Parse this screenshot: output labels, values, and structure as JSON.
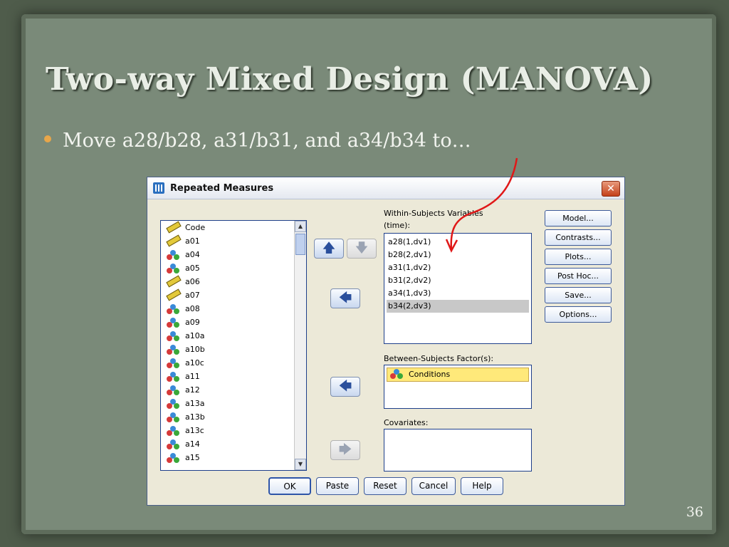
{
  "slide": {
    "title": "Two-way Mixed Design (MANOVA)",
    "bullet": "Move a28/b28, a31/b31, and a34/b34 to…",
    "page_number": "36",
    "accent_color": "#e8a64a",
    "annotation_arrow_color": "#e01818"
  },
  "dialog": {
    "title": "Repeated Measures",
    "close_label": "✕",
    "variables": [
      {
        "name": "Code",
        "icon": "scale-ruler-icon"
      },
      {
        "name": "a01",
        "icon": "scale-ruler-icon"
      },
      {
        "name": "a04",
        "icon": "nominal-icon"
      },
      {
        "name": "a05",
        "icon": "nominal-icon"
      },
      {
        "name": "a06",
        "icon": "scale-ruler-icon"
      },
      {
        "name": "a07",
        "icon": "scale-ruler-icon"
      },
      {
        "name": "a08",
        "icon": "nominal-icon"
      },
      {
        "name": "a09",
        "icon": "nominal-icon"
      },
      {
        "name": "a10a",
        "icon": "nominal-icon"
      },
      {
        "name": "a10b",
        "icon": "nominal-icon"
      },
      {
        "name": "a10c",
        "icon": "nominal-icon"
      },
      {
        "name": "a11",
        "icon": "nominal-icon"
      },
      {
        "name": "a12",
        "icon": "nominal-icon"
      },
      {
        "name": "a13a",
        "icon": "nominal-icon"
      },
      {
        "name": "a13b",
        "icon": "nominal-icon"
      },
      {
        "name": "a13c",
        "icon": "nominal-icon"
      },
      {
        "name": "a14",
        "icon": "nominal-icon"
      },
      {
        "name": "a15",
        "icon": "nominal-icon"
      }
    ],
    "within_label_line1": "Within-Subjects Variables",
    "within_label_line2": "(time):",
    "within_items": [
      {
        "label": "a28(1,dv1)",
        "selected": false
      },
      {
        "label": "b28(2,dv1)",
        "selected": false
      },
      {
        "label": "a31(1,dv2)",
        "selected": false
      },
      {
        "label": "b31(2,dv2)",
        "selected": false
      },
      {
        "label": "a34(1,dv3)",
        "selected": false
      },
      {
        "label": "b34(2,dv3)",
        "selected": true
      }
    ],
    "between_label": "Between-Subjects Factor(s):",
    "between_items": [
      "Conditions"
    ],
    "covariates_label": "Covariates:",
    "side_buttons": [
      "Model...",
      "Contrasts...",
      "Plots...",
      "Post Hoc...",
      "Save...",
      "Options..."
    ],
    "bottom_buttons": [
      "OK",
      "Paste",
      "Reset",
      "Cancel",
      "Help"
    ],
    "up_arrow": "🡅",
    "down_arrow": "🡇",
    "left_arrow": "🡄",
    "right_arrow": "🡆"
  }
}
